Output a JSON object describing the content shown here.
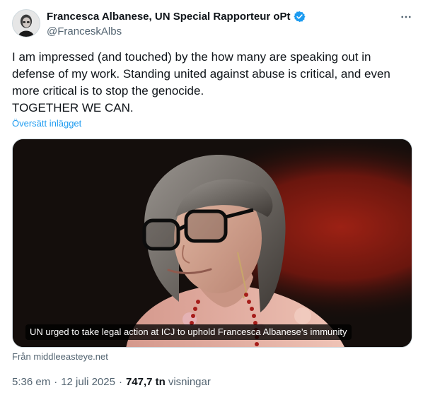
{
  "author": {
    "display_name": "Francesca Albanese, UN Special Rapporteur oPt",
    "handle": "@FranceskAlbs",
    "verified_icon": "verified-badge-icon",
    "verified_color": "#1d9bf0"
  },
  "more_icon": "more-horizontal-icon",
  "tweet": {
    "text_lines": [
      "I am impressed (and touched) by the how many are speaking out in",
      "defense of my work. Standing united against abuse is critical, and even",
      "more critical is to stop the genocide.",
      "TOGETHER WE CAN."
    ],
    "translate_label": "Översätt inlägget"
  },
  "media": {
    "caption": "UN urged to take legal action at ICJ to uphold Francesca Albanese’s immunity",
    "source_label": "Från middleeasteye.net"
  },
  "meta": {
    "time": "5:36 em",
    "separator": "·",
    "date": "12 juli 2025",
    "views_count": "747,7 tn",
    "views_label": "visningar"
  },
  "colors": {
    "text_primary": "#0f1419",
    "text_secondary": "#536471",
    "link": "#1d9bf0"
  }
}
